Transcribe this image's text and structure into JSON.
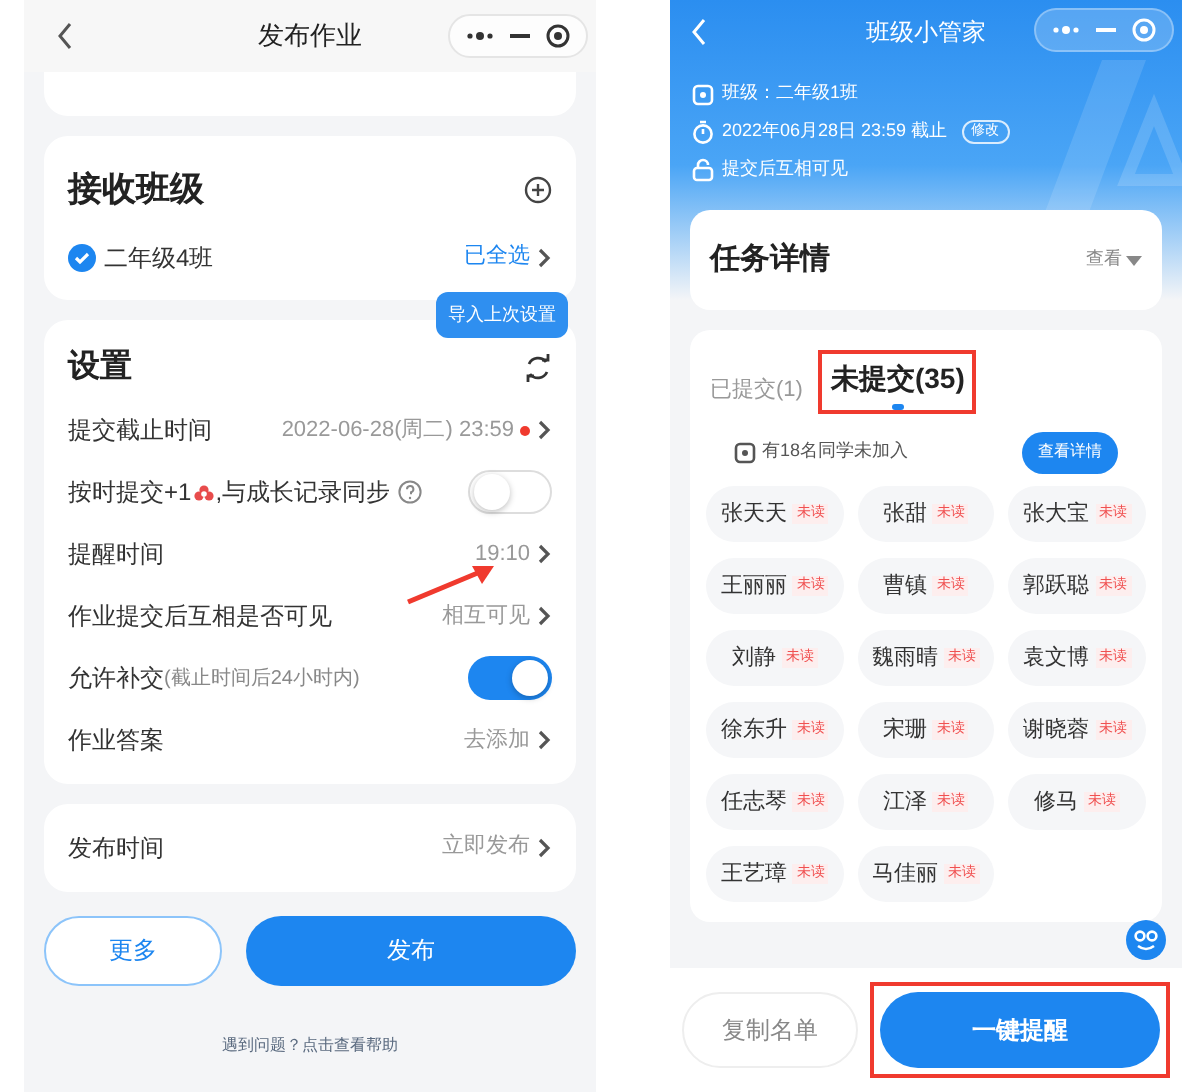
{
  "left": {
    "title": "发布作业",
    "class_section": {
      "title": "接收班级",
      "classes": [
        {
          "name": "二年级4班",
          "checked": true
        }
      ],
      "select_all": "已全选"
    },
    "tooltip": "导入上次设置",
    "settings": {
      "title": "设置",
      "rows": [
        {
          "kind": "value",
          "label": "提交截止时间",
          "value": "2022-06-28(周二) 23:59",
          "alert": true
        },
        {
          "kind": "toggle",
          "label": "按时提交+1",
          "suffix": ",与成长记录同步",
          "on": false
        },
        {
          "kind": "value",
          "label": "提醒时间",
          "value": "19:10",
          "alert": false
        },
        {
          "kind": "value",
          "label": "作业提交后互相是否可见",
          "value": "相互可见",
          "alert": false
        },
        {
          "kind": "toggle",
          "label": "允许补交",
          "note": "(截止时间后24小时内)",
          "on": true
        },
        {
          "kind": "value",
          "label": "作业答案",
          "value": "去添加",
          "alert": false
        }
      ]
    },
    "publish_time": {
      "label": "发布时间",
      "value": "立即发布"
    },
    "buttons": [
      {
        "label": "更多",
        "kind": "outline"
      },
      {
        "label": "发布",
        "kind": "primary"
      }
    ],
    "help": "遇到问题？点击查看帮助"
  },
  "right": {
    "title": "班级小管家",
    "info": [
      {
        "kind": "class",
        "text": "班级：二年级1班"
      },
      {
        "kind": "deadline",
        "text": "2022年06月28日 23:59 截止",
        "badge": "修改"
      },
      {
        "kind": "visibility",
        "text": "提交后互相可见"
      }
    ],
    "task": {
      "title": "任务详情",
      "view": "查看"
    },
    "tabs": [
      {
        "label": "已提交(1)",
        "selected": false
      },
      {
        "label": "未提交(35)",
        "selected": true
      }
    ],
    "notice": {
      "text": "有18名同学未加入",
      "button": "查看详情"
    },
    "students": [
      {
        "name": "张天天",
        "status": "未读"
      },
      {
        "name": "张甜",
        "status": "未读"
      },
      {
        "name": "张大宝",
        "status": "未读"
      },
      {
        "name": "王丽丽",
        "status": "未读"
      },
      {
        "name": "曹镇",
        "status": "未读"
      },
      {
        "name": "郭跃聪",
        "status": "未读"
      },
      {
        "name": "刘静",
        "status": "未读"
      },
      {
        "name": "魏雨晴",
        "status": "未读"
      },
      {
        "name": "袁文博",
        "status": "未读"
      },
      {
        "name": "徐东升",
        "status": "未读"
      },
      {
        "name": "宋珊",
        "status": "未读"
      },
      {
        "name": "谢晓蓉",
        "status": "未读"
      },
      {
        "name": "任志琴",
        "status": "未读"
      },
      {
        "name": "江泽",
        "status": "未读"
      },
      {
        "name": "修马",
        "status": "未读"
      },
      {
        "name": "王艺璋",
        "status": "未读"
      },
      {
        "name": "马佳丽",
        "status": "未读"
      }
    ],
    "buttons": [
      {
        "label": "复制名单",
        "kind": "outline"
      },
      {
        "label": "一键提醒",
        "kind": "primary"
      }
    ]
  }
}
